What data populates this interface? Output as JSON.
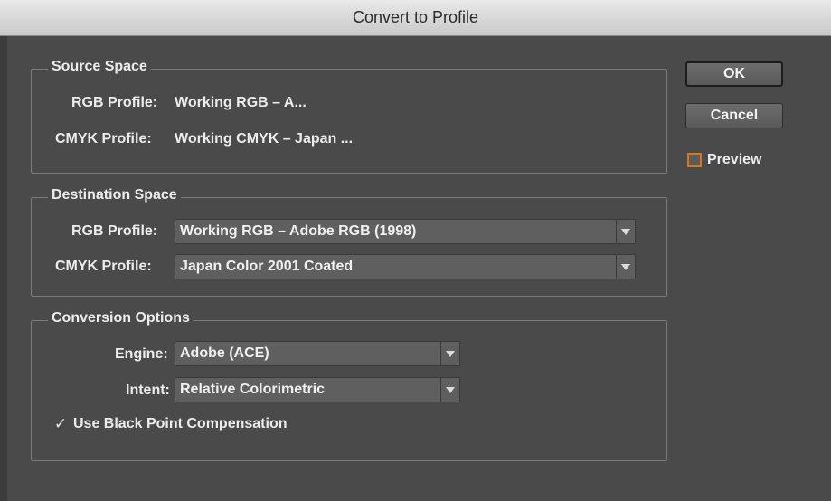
{
  "window": {
    "title": "Convert to Profile"
  },
  "buttons": {
    "ok": "OK",
    "cancel": "Cancel"
  },
  "preview": {
    "label": "Preview",
    "checked": false
  },
  "source_space": {
    "legend": "Source Space",
    "rgb_label": "RGB Profile:",
    "rgb_value": "Working RGB – A...",
    "cmyk_label": "CMYK Profile:",
    "cmyk_value": "Working CMYK – Japan ..."
  },
  "destination_space": {
    "legend": "Destination Space",
    "rgb_label": "RGB Profile:",
    "rgb_value": "Working RGB – Adobe RGB (1998)",
    "cmyk_label": "CMYK Profile:",
    "cmyk_value": "Japan Color 2001 Coated"
  },
  "conversion_options": {
    "legend": "Conversion Options",
    "engine_label": "Engine:",
    "engine_value": "Adobe (ACE)",
    "intent_label": "Intent:",
    "intent_value": "Relative Colorimetric",
    "bpc_label": "Use Black Point Compensation",
    "bpc_checked": true,
    "bpc_mark": "✓"
  },
  "colors": {
    "accent_checkbox": "#d47a1a",
    "panel_bg": "#4a4a4a"
  },
  "icons": {
    "dropdown": "chevron-down-icon",
    "check": "checkmark-icon"
  }
}
